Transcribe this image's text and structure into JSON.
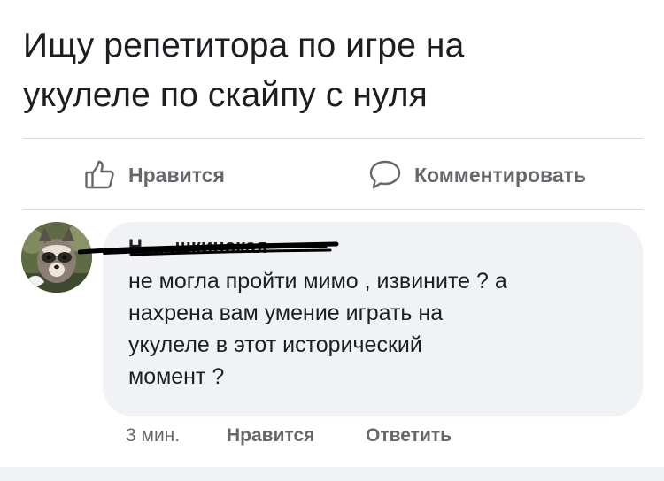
{
  "post": {
    "text_line1": "Ищу репетитора по игре на",
    "text_line2": "укулеле по скайпу с нуля"
  },
  "actions": {
    "like_label": "Нравится",
    "comment_label": "Комментировать"
  },
  "comment": {
    "author": "Н......шкинская",
    "lines": [
      "не могла пройти мимо , извините ? а",
      "нахрена вам умение играть на",
      "укулеле в этот исторический",
      "момент ?"
    ],
    "time": "3 мин.",
    "like_label": "Нравится",
    "reply_label": "Ответить"
  },
  "colors": {
    "text": "#1c1e21",
    "secondary": "#65676b",
    "bubble": "#f0f2f5",
    "divider": "#d8dadf"
  },
  "icons": {
    "like": "thumbs-up-icon",
    "comment": "speech-bubble-icon"
  }
}
